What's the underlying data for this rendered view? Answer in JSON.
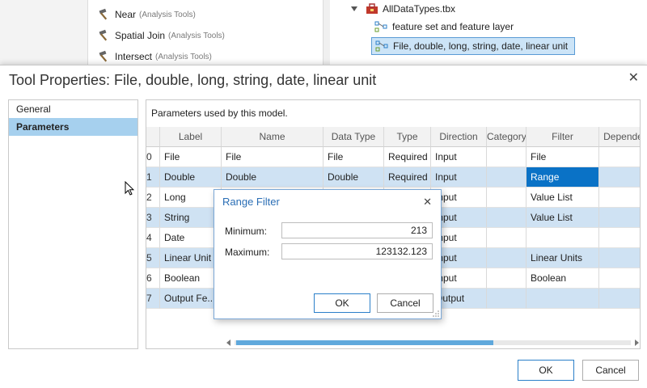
{
  "background": {
    "tools": [
      {
        "name": "Near",
        "source": "(Analysis Tools)"
      },
      {
        "name": "Spatial Join",
        "source": "(Analysis Tools)"
      },
      {
        "name": "Intersect",
        "source": "(Analysis Tools)"
      }
    ],
    "tree": {
      "toolbox": "AllDataTypes.tbx",
      "items": [
        "feature set and feature layer",
        "File, double, long, string, date, linear unit"
      ]
    }
  },
  "dialog": {
    "title": "Tool Properties: File, double, long, string, date, linear unit",
    "close_glyph": "✕",
    "nav": [
      "General",
      "Parameters"
    ],
    "caption": "Parameters used by this model.",
    "columns": [
      "",
      "Label",
      "Name",
      "Data Type",
      "Type",
      "Direction",
      "Category",
      "Filter",
      "Depende"
    ],
    "rows": [
      [
        "0",
        "File",
        "File",
        "File",
        "Required",
        "Input",
        "",
        "File",
        ""
      ],
      [
        "1",
        "Double",
        "Double",
        "Double",
        "Required",
        "Input",
        "",
        "Range",
        ""
      ],
      [
        "2",
        "Long",
        "",
        "",
        "",
        "Input",
        "",
        "Value List",
        ""
      ],
      [
        "3",
        "String",
        "",
        "",
        "",
        "Input",
        "",
        "Value List",
        ""
      ],
      [
        "4",
        "Date",
        "",
        "",
        "",
        "Input",
        "",
        "",
        ""
      ],
      [
        "5",
        "Linear Unit",
        "",
        "",
        "",
        "Input",
        "",
        "Linear Units",
        ""
      ],
      [
        "6",
        "Boolean",
        "",
        "",
        "",
        "Input",
        "",
        "Boolean",
        ""
      ],
      [
        "7",
        "Output Fe...",
        "",
        "",
        "",
        "Output",
        "",
        "",
        ""
      ]
    ],
    "ok": "OK",
    "cancel": "Cancel"
  },
  "range_filter": {
    "title": "Range Filter",
    "close_glyph": "✕",
    "minimum_label": "Minimum:",
    "minimum_value": "213",
    "maximum_label": "Maximum:",
    "maximum_value": "123132.123",
    "ok": "OK",
    "cancel": "Cancel"
  },
  "colors": {
    "selection": "#cfe2f3",
    "accent": "#0a72c6",
    "nav_active": "#a6d0ee"
  }
}
